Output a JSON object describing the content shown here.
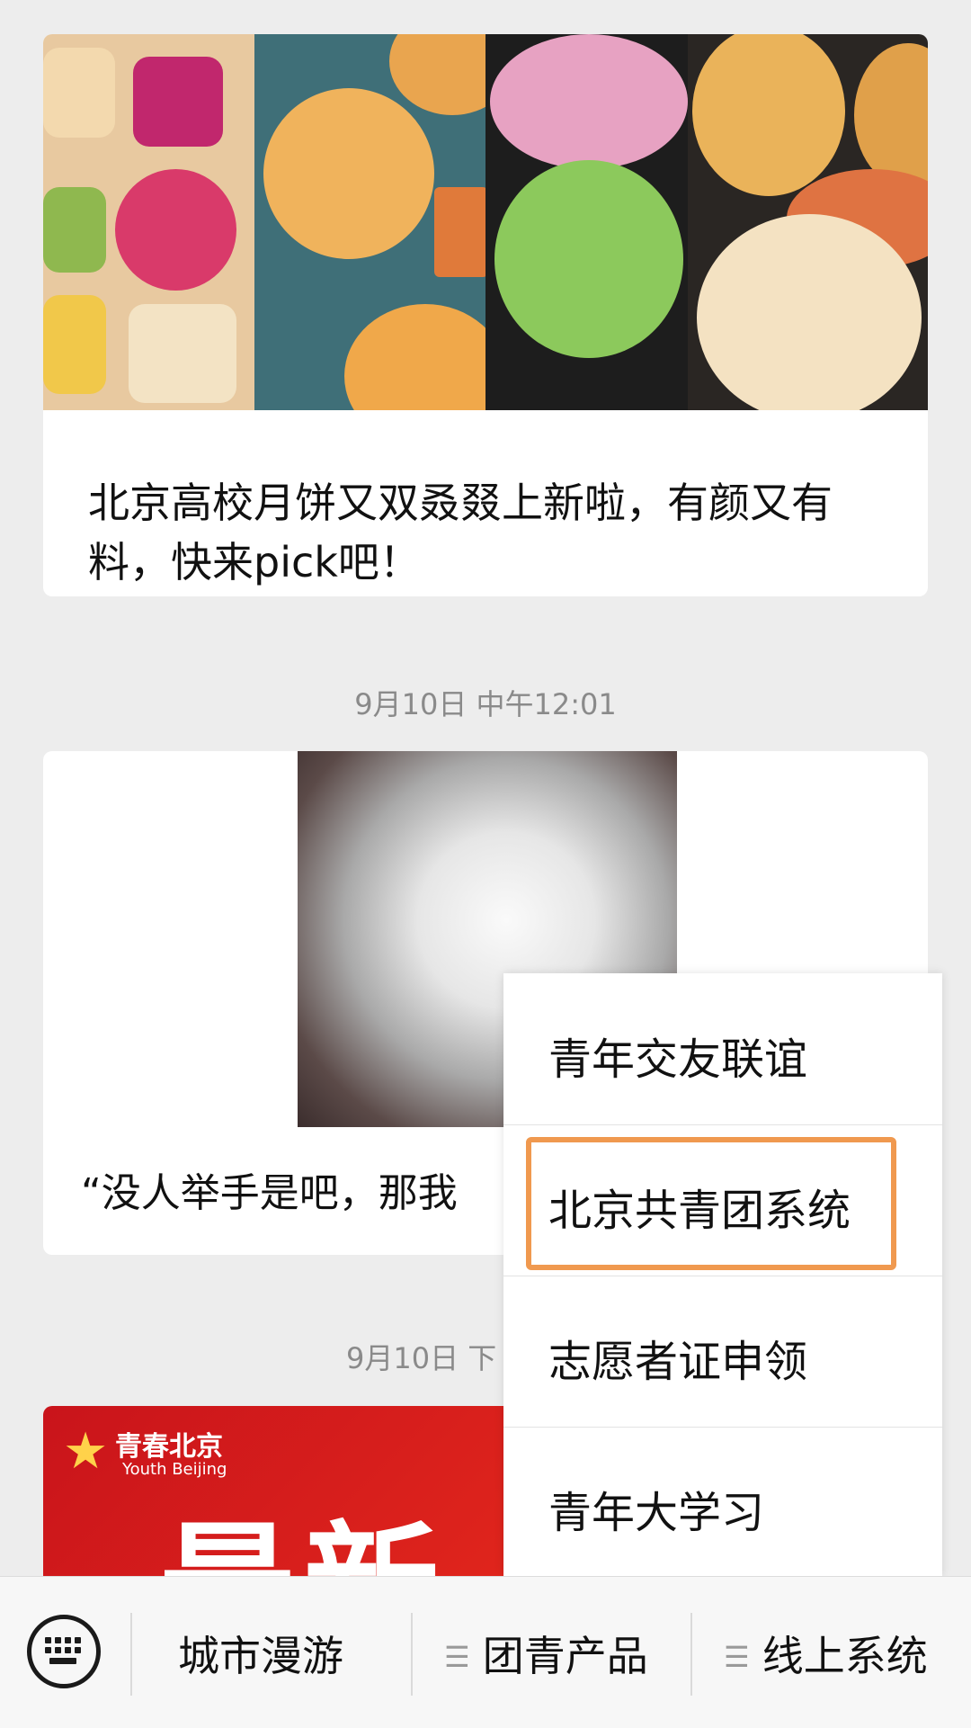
{
  "feed": {
    "article1": {
      "title": "北京高校月饼又双叒叕上新啦，有颜又有料，快来pick吧！"
    },
    "timestamp1": "9月10日 中午12:01",
    "article2": {
      "title": "“没人举手是吧，那我"
    },
    "timestamp2": "9月10日 下",
    "banner": {
      "brand": "青春北京",
      "brand_en": "Youth Beijing",
      "headline": "最新"
    }
  },
  "popup_menu": {
    "items": [
      "青年交友联谊",
      "北京共青团系统",
      "志愿者证申领",
      "青年大学习"
    ],
    "highlighted": "北京共青团系统",
    "highlight_color": "#f0994f"
  },
  "bottom_bar": {
    "keyboard_icon": "keyboard-icon",
    "tabs": [
      "城市漫游",
      "团青产品",
      "线上系统"
    ],
    "menu_icon": "menu-lines-icon"
  }
}
